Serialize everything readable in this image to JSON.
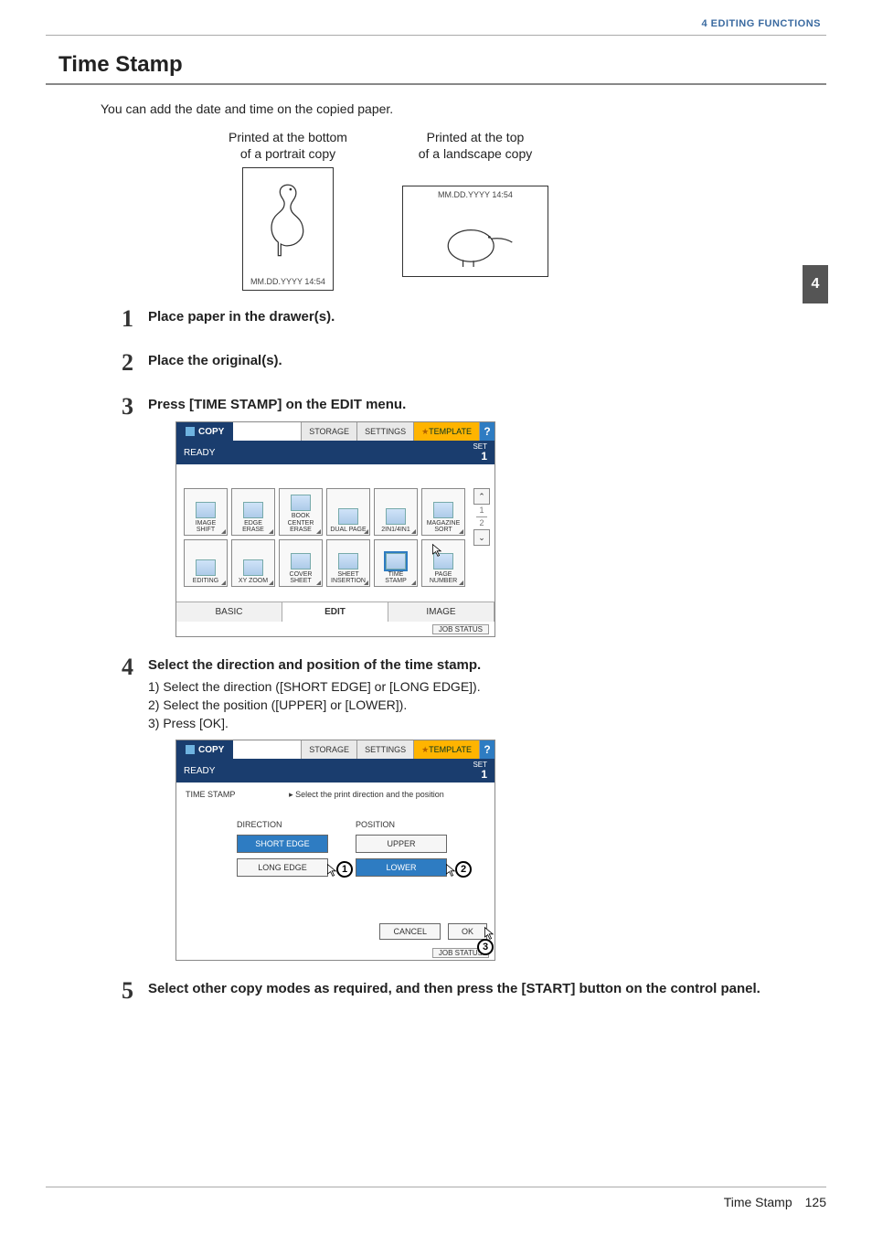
{
  "header": {
    "chapter_label": "4 EDITING FUNCTIONS",
    "chapter_tab": "4"
  },
  "title": "Time Stamp",
  "intro": "You can add the date and time on the copied paper.",
  "figures": {
    "portrait_caption_l1": "Printed at the bottom",
    "portrait_caption_l2": "of a portrait copy",
    "portrait_ts": "MM.DD.YYYY  14:54",
    "landscape_caption_l1": "Printed at the top",
    "landscape_caption_l2": "of a landscape copy",
    "landscape_ts": "MM.DD.YYYY  14:54"
  },
  "steps": {
    "s1": "Place paper in the drawer(s).",
    "s2": "Place the original(s).",
    "s3": "Press [TIME STAMP] on the EDIT menu.",
    "s4": "Select the direction and position of the time stamp.",
    "s4_sub1": "1)  Select the direction ([SHORT EDGE] or [LONG EDGE]).",
    "s4_sub2": "2)  Select the position ([UPPER] or [LOWER]).",
    "s4_sub3": "3)  Press [OK].",
    "s5": "Select other copy modes as required, and then press the [START] button on the control panel."
  },
  "screen1": {
    "mode": "COPY",
    "tabs": {
      "storage": "STORAGE",
      "settings": "SETTINGS",
      "template": "TEMPLATE",
      "help": "?"
    },
    "status": "READY",
    "set_label": "SET",
    "set_value": "1",
    "cells": [
      "IMAGE SHIFT",
      "EDGE ERASE",
      "BOOK CENTER ERASE",
      "DUAL PAGE",
      "2IN1/4IN1",
      "MAGAZINE SORT",
      "EDITING",
      "XY ZOOM",
      "COVER SHEET",
      "SHEET INSERTION",
      "TIME STAMP",
      "PAGE NUMBER"
    ],
    "scroll": {
      "up": "⌃",
      "down": "⌄",
      "frac_top": "1",
      "frac_bot": "2"
    },
    "bottom_tabs": {
      "basic": "BASIC",
      "edit": "EDIT",
      "image": "IMAGE"
    },
    "job_status": "JOB STATUS"
  },
  "screen2": {
    "mode": "COPY",
    "tabs": {
      "storage": "STORAGE",
      "settings": "SETTINGS",
      "template": "TEMPLATE",
      "help": "?"
    },
    "status": "READY",
    "set_label": "SET",
    "set_value": "1",
    "heading": "TIME STAMP",
    "hint": "▸ Select the print direction and the position",
    "direction_label": "DIRECTION",
    "position_label": "POSITION",
    "short_edge": "SHORT EDGE",
    "long_edge": "LONG EDGE",
    "upper": "UPPER",
    "lower": "LOWER",
    "cancel": "CANCEL",
    "ok": "OK",
    "job_status": "JOB STATUS",
    "callouts": {
      "c1": "1",
      "c2": "2",
      "c3": "3"
    }
  },
  "footer": {
    "title": "Time Stamp",
    "page": "125"
  }
}
